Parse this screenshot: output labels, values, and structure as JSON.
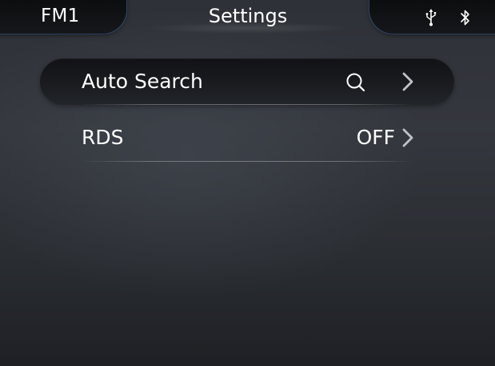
{
  "statusbar": {
    "band": "FM1",
    "title": "Settings",
    "icons": [
      "usb-icon",
      "bluetooth-icon"
    ]
  },
  "settings": {
    "items": [
      {
        "label": "Auto Search",
        "value": "",
        "value_icon": "search-icon",
        "chevron": "chevron-right-icon",
        "selected": true
      },
      {
        "label": "RDS",
        "value": "OFF",
        "chevron": "chevron-right-icon",
        "selected": false
      }
    ]
  },
  "colors": {
    "text": "#ffffff",
    "background": "#2e3137",
    "bar": "#0a0b0d",
    "accent_edge": "#4678c8"
  }
}
